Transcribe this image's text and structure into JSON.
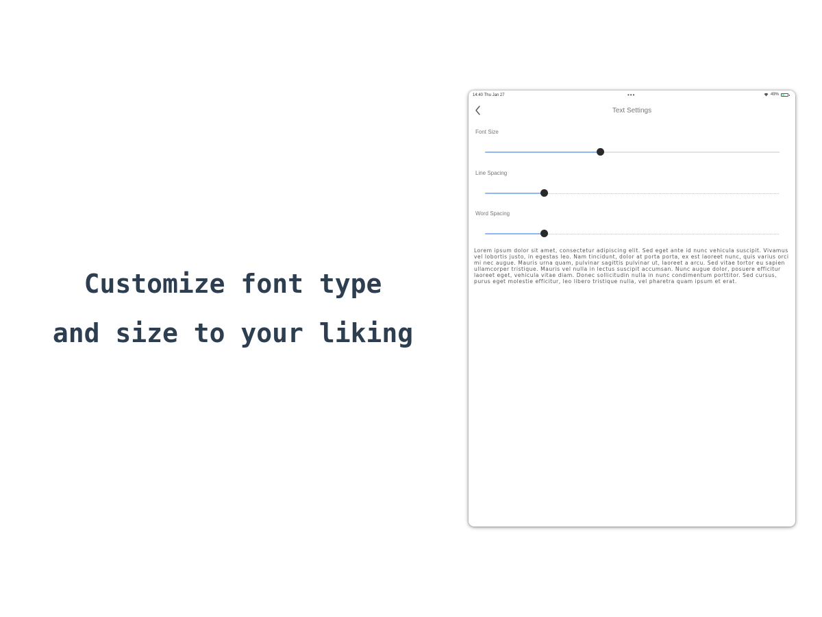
{
  "promo": {
    "line1": "Customize font type",
    "line2": "and size to your liking"
  },
  "tablet": {
    "status_bar": {
      "time": "14:40   Thu Jan 27",
      "dots": "•••",
      "battery_text": "49%",
      "battery_level": 0.49
    },
    "nav": {
      "title": "Text Settings",
      "back_icon": "chevron-left-icon"
    },
    "settings": [
      {
        "label": "Font Size",
        "value": 0.39
      },
      {
        "label": "Line Spacing",
        "value": 0.2
      },
      {
        "label": "Word Spacing",
        "value": 0.2
      }
    ],
    "preview_text": "Lorem ipsum dolor sit amet, consectetur adipiscing elit. Sed eget ante id nunc vehicula suscipit. Vivamus vel lobortis justo, in egestas leo. Nam tincidunt, dolor at porta porta, ex est laoreet nunc, quis varius orci mi nec augue. Mauris urna quam, pulvinar sagittis pulvinar ut, laoreet a arcu. Sed vitae tortor eu sapien ullamcorper tristique. Mauris vel nulla in lectus suscipit accumsan. Nunc augue dolor, posuere efficitur laoreet eget, vehicula vitae diam. Donec sollicitudin nulla in nunc condimentum porttitor. Sed cursus, purus eget molestie efficitur, leo libero tristique nulla, vel pharetra quam ipsum et erat."
  },
  "colors": {
    "promo_text": "#2d3e50",
    "slider_fill": "#8fb7f2",
    "slider_thumb": "#2a2a2a"
  }
}
